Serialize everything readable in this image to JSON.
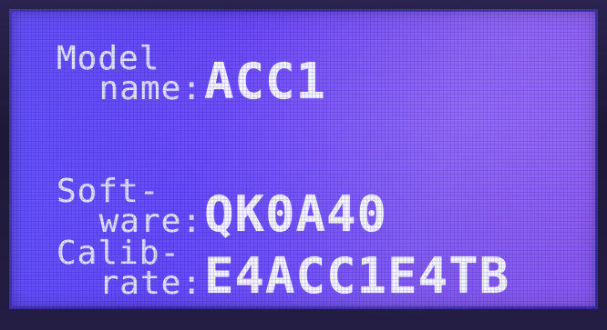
{
  "display": {
    "model": {
      "label_line1": "Model",
      "label_line2": " name:",
      "value": "ACC1"
    },
    "software": {
      "label_line1": "Soft-",
      "label_line2": " ware:",
      "value": "QK0A40"
    },
    "calibrate": {
      "label_line1": "Calib-",
      "label_line2": " rate:",
      "value": "E4ACC1E4TB"
    }
  },
  "colors": {
    "screen_background": "#6a48f0",
    "text": "#f4f4ff"
  }
}
